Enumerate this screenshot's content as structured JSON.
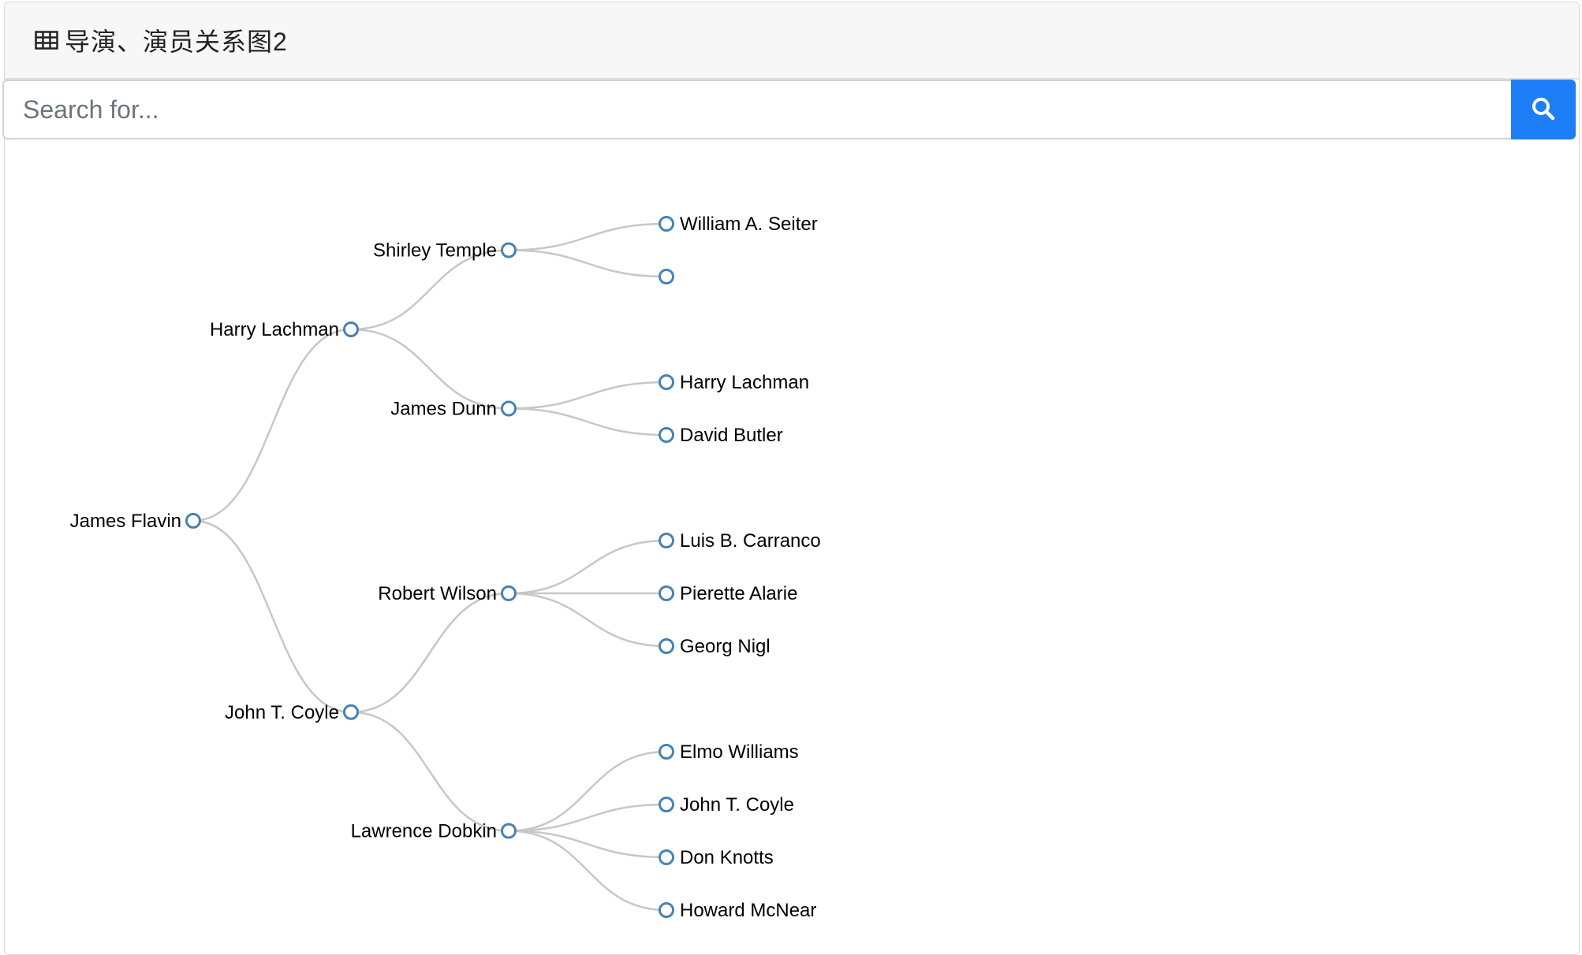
{
  "header": {
    "icon": "table-icon",
    "title": "导演、演员关系图2"
  },
  "search": {
    "placeholder": "Search for...",
    "value": "",
    "button_icon": "search-icon",
    "button_color": "#1e7ef7"
  },
  "colors": {
    "node_stroke": "#4682b4",
    "link_stroke": "#c7c7c7"
  },
  "tree": {
    "name": "James Flavin",
    "children": [
      {
        "name": "Harry Lachman",
        "children": [
          {
            "name": "Shirley Temple",
            "children": [
              {
                "name": "William A. Seiter"
              },
              {
                "name": ""
              }
            ]
          },
          {
            "name": "James Dunn",
            "children": [
              {
                "name": "Harry Lachman"
              },
              {
                "name": "David Butler"
              }
            ]
          }
        ]
      },
      {
        "name": "John T. Coyle",
        "children": [
          {
            "name": "Robert Wilson",
            "children": [
              {
                "name": "Luis B. Carranco"
              },
              {
                "name": "Pierette Alarie"
              },
              {
                "name": "Georg Nigl"
              }
            ]
          },
          {
            "name": "Lawrence Dobkin",
            "children": [
              {
                "name": "Elmo Williams"
              },
              {
                "name": "John T. Coyle"
              },
              {
                "name": "Don Knotts"
              },
              {
                "name": "Howard McNear"
              }
            ]
          }
        ]
      }
    ]
  }
}
